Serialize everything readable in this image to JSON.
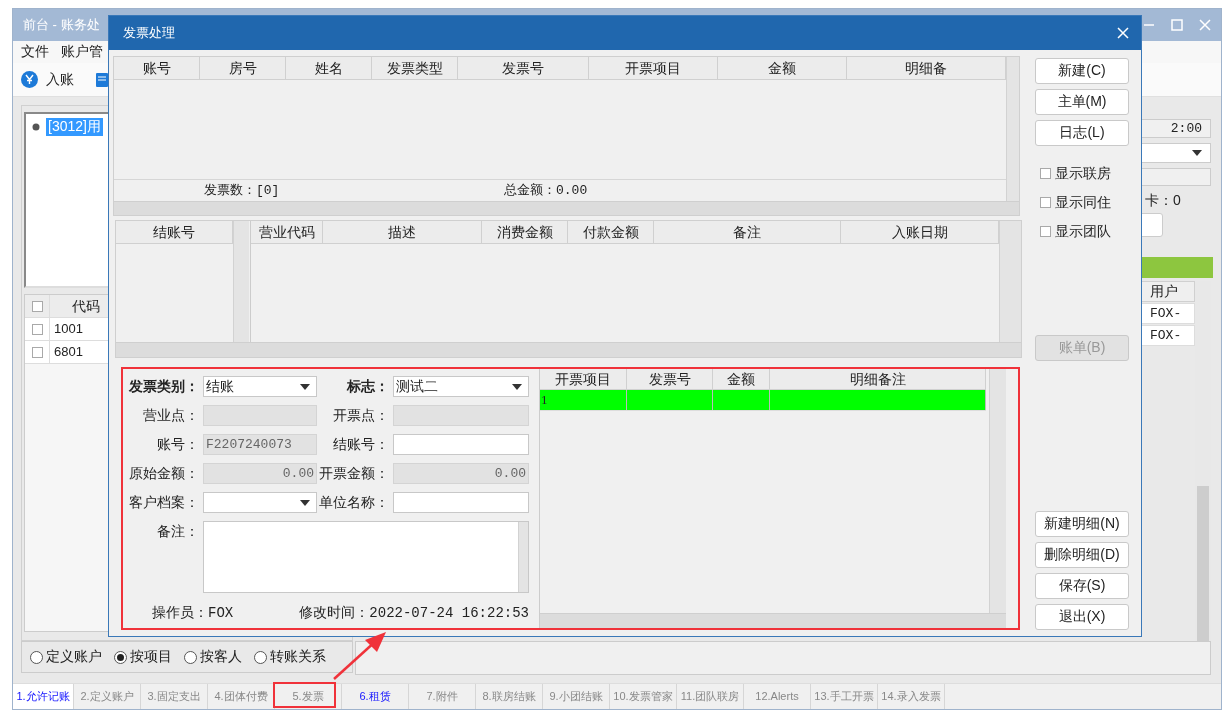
{
  "main_window": {
    "title": "前台 - 账务处",
    "menu": [
      "文件",
      "账户管"
    ],
    "toolbar": [
      {
        "label": "入账"
      }
    ],
    "tree": [
      {
        "label": "[3012]用",
        "selected": true
      }
    ],
    "code_table": {
      "columns": [
        "代码"
      ],
      "all_checked": false,
      "rows": [
        {
          "code": "1001",
          "checked": false
        },
        {
          "code": "6801",
          "checked": false
        }
      ]
    },
    "side_panel": {
      "time_field": "2:00",
      "card_label": "卡：0",
      "user_table": {
        "columns": [
          "用户"
        ],
        "rows": [
          "FOX-",
          "FOX-"
        ]
      }
    },
    "view_options": [
      {
        "label": "定义账户",
        "selected": false
      },
      {
        "label": "按项目",
        "selected": true
      },
      {
        "label": "按客人",
        "selected": false
      },
      {
        "label": "转账关系",
        "selected": false
      }
    ],
    "tabs": [
      {
        "label": "1.允许记账",
        "selected": true,
        "highlighted": true
      },
      {
        "label": "2.定义账户",
        "selected": false,
        "highlighted": false
      },
      {
        "label": "3.固定支出",
        "selected": false,
        "highlighted": false
      },
      {
        "label": "4.团体付费",
        "selected": false,
        "highlighted": false
      },
      {
        "label": "5.发票",
        "selected": false,
        "highlighted": false
      },
      {
        "label": "6.租赁",
        "selected": false,
        "highlighted": true
      },
      {
        "label": "7.附件",
        "selected": false,
        "highlighted": false
      },
      {
        "label": "8.联房结账",
        "selected": false,
        "highlighted": false
      },
      {
        "label": "9.小团结账",
        "selected": false,
        "highlighted": false
      },
      {
        "label": "10.发票管家",
        "selected": false,
        "highlighted": false
      },
      {
        "label": "11.团队联房",
        "selected": false,
        "highlighted": false
      },
      {
        "label": "12.Alerts",
        "selected": false,
        "highlighted": false
      },
      {
        "label": "13.手工开票",
        "selected": false,
        "highlighted": false
      },
      {
        "label": "14.录入发票",
        "selected": false,
        "highlighted": false
      }
    ]
  },
  "dialog": {
    "title": "发票处理",
    "invoice_table": {
      "columns": [
        "账号",
        "房号",
        "姓名",
        "发票类型",
        "发票号",
        "开票项目",
        "金额",
        "明细备"
      ],
      "summary": [
        "发票数：[0]",
        "总金额：0.00"
      ]
    },
    "folio_table": {
      "columns": [
        "结账号"
      ]
    },
    "entry_table": {
      "columns": [
        "营业代码",
        "描述",
        "消费金额",
        "付款金额",
        "备注",
        "入账日期"
      ]
    },
    "form": {
      "fields": [
        {
          "label": "发票类别：",
          "kind": "select",
          "value": "结账",
          "required": true,
          "disabled": false
        },
        {
          "label": "标志：",
          "kind": "select",
          "value": "测试二",
          "required": true,
          "disabled": false
        },
        {
          "label": "营业点：",
          "kind": "text",
          "required": false,
          "disabled": true
        },
        {
          "label": "开票点：",
          "kind": "text",
          "required": false,
          "disabled": true
        },
        {
          "label": "账号：",
          "kind": "text",
          "value": "F2207240073",
          "required": false,
          "disabled": true
        },
        {
          "label": "结账号：",
          "kind": "text",
          "required": false,
          "disabled": false
        },
        {
          "label": "原始金额：",
          "kind": "amount",
          "value": "0.00",
          "required": false,
          "disabled": true
        },
        {
          "label": "开票金额：",
          "kind": "amount",
          "value": "0.00",
          "required": false,
          "disabled": true
        },
        {
          "label": "客户档案：",
          "kind": "select",
          "required": false,
          "disabled": false
        },
        {
          "label": "单位名称：",
          "kind": "text",
          "required": false,
          "disabled": false
        }
      ],
      "remark_label": "备注：",
      "operator": "操作员：FOX",
      "modified": "修改时间：2022-07-24 16:22:53"
    },
    "detail_table": {
      "columns": [
        "开票项目",
        "发票号",
        "金额",
        "明细备注"
      ],
      "rows": [
        {
          "cells": [
            "1"
          ],
          "selected": true
        }
      ]
    },
    "top_buttons": [
      {
        "label": "新建(C)",
        "disabled": false
      },
      {
        "label": "主单(M)",
        "disabled": false
      },
      {
        "label": "日志(L)",
        "disabled": false
      }
    ],
    "checkboxes": [
      {
        "label": "显示联房",
        "checked": false
      },
      {
        "label": "显示同住",
        "checked": false
      },
      {
        "label": "显示团队",
        "checked": false
      }
    ],
    "bill_button": {
      "label": "账单(B)",
      "disabled": true
    },
    "bottom_buttons": [
      {
        "label": "新建明细(N)",
        "disabled": false
      },
      {
        "label": "删除明细(D)",
        "disabled": false
      },
      {
        "label": "保存(S)",
        "disabled": false
      },
      {
        "label": "退出(X)",
        "disabled": false
      }
    ]
  }
}
